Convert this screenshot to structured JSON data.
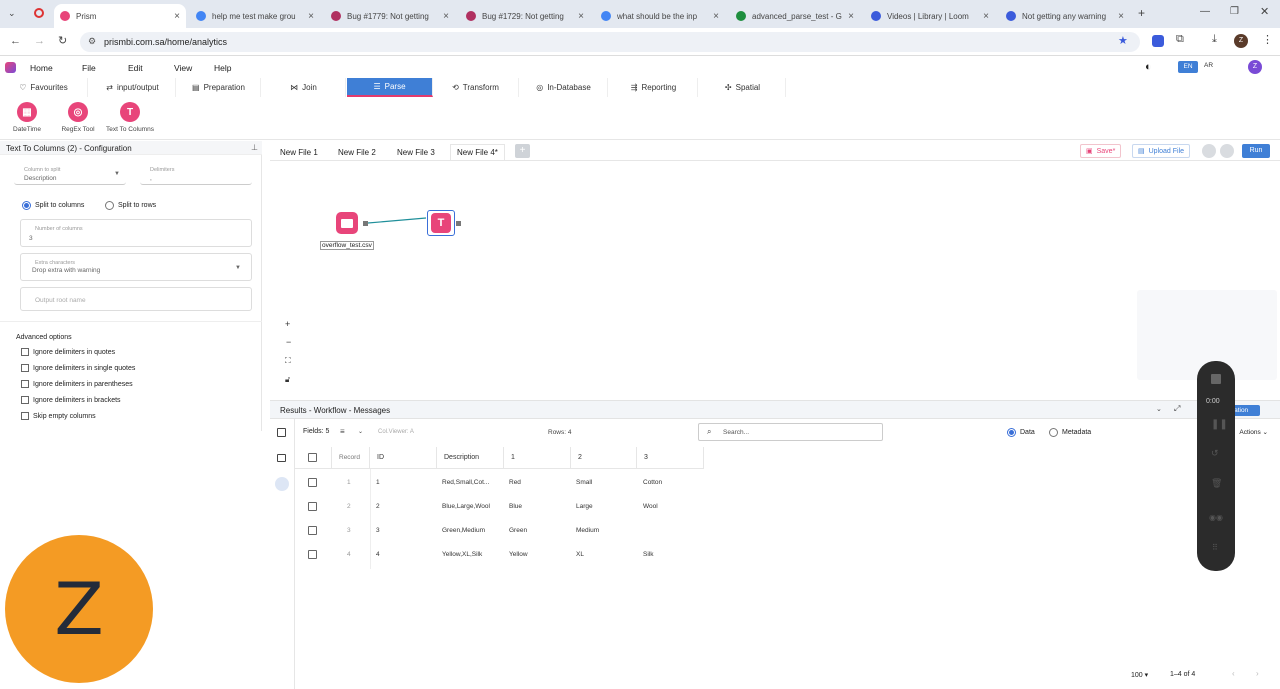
{
  "browser": {
    "tabs": [
      {
        "title": "Prism",
        "color": "#e8457a",
        "active": true
      },
      {
        "title": "help me test make grou",
        "color": "#4285f4"
      },
      {
        "title": "Bug #1779: Not getting",
        "color": "#b03060"
      },
      {
        "title": "Bug #1729: Not getting",
        "color": "#b03060"
      },
      {
        "title": "what should be the inp",
        "color": "#4285f4"
      },
      {
        "title": "advanced_parse_test - G",
        "color": "#1e8e3e"
      },
      {
        "title": "Videos | Library | Loom",
        "color": "#3b5bdb"
      },
      {
        "title": "Not getting any warning",
        "color": "#3b5bdb"
      }
    ],
    "url": "prismbi.com.sa/home/analytics"
  },
  "menu": {
    "home": "Home",
    "file": "File",
    "edit": "Edit",
    "view": "View",
    "help": "Help",
    "lang_en": "EN",
    "lang_ar": "AR",
    "user_initial": "Z"
  },
  "ribbon": [
    "Favourites",
    "input/output",
    "Preparation",
    "Join",
    "Parse",
    "Transform",
    "In-Database",
    "Reporting",
    "Spatial"
  ],
  "tools": [
    {
      "label": "DateTime",
      "glyph": "▦"
    },
    {
      "label": "RegEx Tool",
      "glyph": "◎"
    },
    {
      "label": "Text To Columns",
      "glyph": "T"
    }
  ],
  "config": {
    "title": "Text To Columns (2) - Configuration",
    "column_label": "Column to split",
    "column_value": "Description",
    "delim_label": "Delimiters",
    "delim_value": ",",
    "split_columns": "Split to columns",
    "split_rows": "Split to rows",
    "num_columns_label": "Number of columns",
    "num_columns_value": "3",
    "extra_label": "Extra characters",
    "extra_value": "Drop extra with warning",
    "output_root_placeholder": "Output root name",
    "advanced_title": "Advanced options",
    "advanced": [
      "Ignore delimiters in quotes",
      "Ignore delimiters in single quotes",
      "Ignore delimiters in parentheses",
      "Ignore delimiters in brackets",
      "Skip empty columns"
    ]
  },
  "filetabs": [
    "New File 1",
    "New File 2",
    "New File 3",
    "New File 4*"
  ],
  "actions": {
    "save": "Save*",
    "upload": "Upload File",
    "run": "Run"
  },
  "canvas": {
    "input_node_label": "overflow_test.csv"
  },
  "results": {
    "title": "Results - Workflow - Messages",
    "fields_label": "Fields: 5",
    "col_viewer": "Col.Viewer: A",
    "rows": "Rows: 4",
    "search_placeholder": "Search...",
    "data": "Data",
    "metadata": "Metadata",
    "visualization": "Visualization",
    "actions_label": "Actions",
    "columns": [
      "Record",
      "ID",
      "Description",
      "1",
      "2",
      "3"
    ],
    "table": [
      [
        "1",
        "1",
        "Red,Small,Cot...",
        "Red",
        "Small",
        "Cotton"
      ],
      [
        "2",
        "2",
        "Blue,Large,Wool",
        "Blue",
        "Large",
        "Wool"
      ],
      [
        "3",
        "3",
        "Green,Medium",
        "Green",
        "Medium",
        ""
      ],
      [
        "4",
        "4",
        "Yellow,XL,Silk",
        "Yellow",
        "XL",
        "Silk"
      ]
    ],
    "page_size": "100",
    "page_range": "1–4 of 4"
  },
  "recorder": {
    "time": "0:00"
  },
  "avatar_letter": "Z"
}
